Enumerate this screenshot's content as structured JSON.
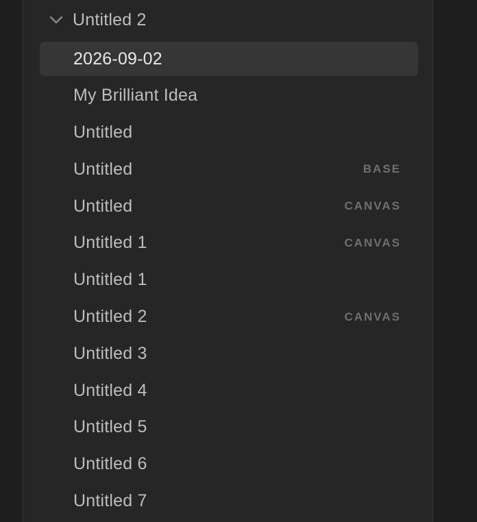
{
  "folder": {
    "name": "Untitled 2",
    "icon": "chevron-down-icon",
    "expanded": true
  },
  "files": [
    {
      "name": "2026-09-02",
      "tag": "",
      "active": true
    },
    {
      "name": "My Brilliant Idea",
      "tag": ""
    },
    {
      "name": "Untitled",
      "tag": ""
    },
    {
      "name": "Untitled",
      "tag": "BASE"
    },
    {
      "name": "Untitled",
      "tag": "CANVAS"
    },
    {
      "name": "Untitled 1",
      "tag": "CANVAS"
    },
    {
      "name": "Untitled 1",
      "tag": ""
    },
    {
      "name": "Untitled 2",
      "tag": "CANVAS"
    },
    {
      "name": "Untitled 3",
      "tag": ""
    },
    {
      "name": "Untitled 4",
      "tag": ""
    },
    {
      "name": "Untitled 5",
      "tag": ""
    },
    {
      "name": "Untitled 6",
      "tag": ""
    },
    {
      "name": "Untitled 7",
      "tag": ""
    }
  ],
  "colors": {
    "background": "#1e1e1e",
    "sidebar": "#262626",
    "active_row": "#363636",
    "text": "#bdbdbd",
    "active_text": "#e8e8e8",
    "tag_text": "#6f6f6f"
  }
}
